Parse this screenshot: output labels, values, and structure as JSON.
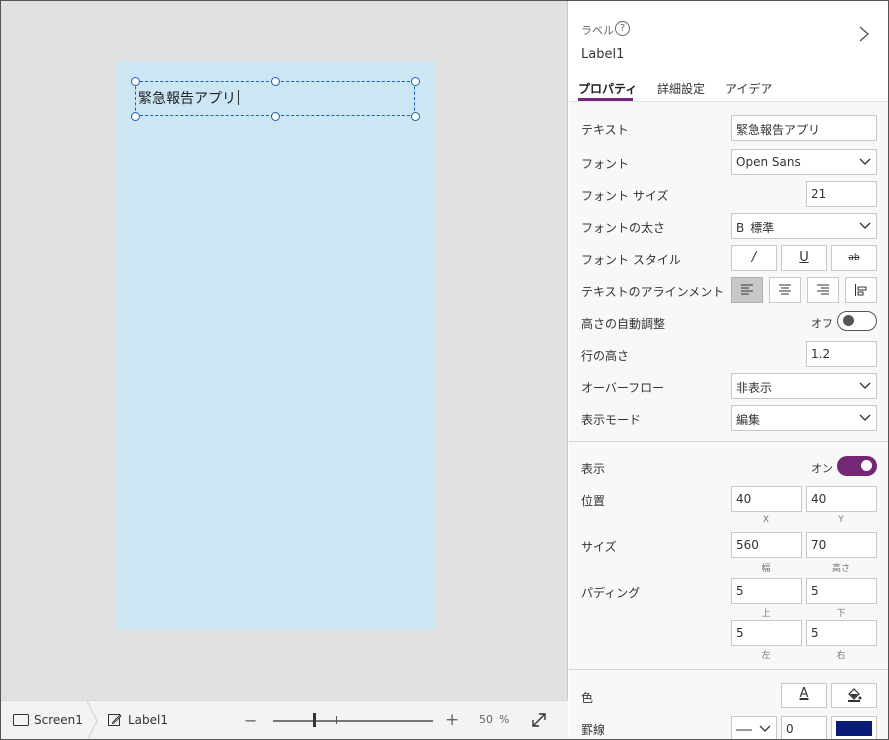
{
  "canvas": {
    "label_text": "緊急報告アプリ",
    "screen_color": "#cce6f4"
  },
  "statusbar": {
    "screen_crumb": "Screen1",
    "label_crumb": "Label1",
    "zoom_minus": "−",
    "zoom_plus": "+",
    "zoom_value": "50",
    "zoom_unit": "%",
    "zoom_level": 0.5
  },
  "panel": {
    "control_type": "ラベル",
    "help_glyph": "?",
    "control_name": "Label1",
    "tabs": [
      {
        "label": "プロパティ",
        "active": true
      },
      {
        "label": "詳細設定",
        "active": false
      },
      {
        "label": "アイデア",
        "active": false
      }
    ],
    "accent_color": "#742774",
    "properties": {
      "text": {
        "label": "テキスト",
        "value": "緊急報告アプリ"
      },
      "font": {
        "label": "フォント",
        "value": "Open Sans"
      },
      "font_size": {
        "label": "フォント サイズ",
        "value": "21"
      },
      "font_weight": {
        "label": "フォントの太さ",
        "prefix": "B",
        "value": "標準"
      },
      "font_style": {
        "label": "フォント スタイル",
        "italic": "/",
        "underline": "U",
        "strike": "ab"
      },
      "text_align": {
        "label": "テキストのアラインメント",
        "selected": "left"
      },
      "auto_height": {
        "label": "高さの自動調整",
        "state": "オフ"
      },
      "line_height": {
        "label": "行の高さ",
        "value": "1.2"
      },
      "overflow": {
        "label": "オーバーフロー",
        "value": "非表示"
      },
      "display_mode": {
        "label": "表示モード",
        "value": "編集"
      },
      "visible": {
        "label": "表示",
        "state": "オン"
      },
      "position": {
        "label": "位置",
        "x": "40",
        "y": "40",
        "x_caption": "X",
        "y_caption": "Y"
      },
      "size": {
        "label": "サイズ",
        "width": "560",
        "height": "70",
        "width_caption": "幅",
        "height_caption": "高さ"
      },
      "padding": {
        "label": "パディング",
        "top": "5",
        "bottom": "5",
        "left": "5",
        "right": "5",
        "top_caption": "上",
        "bottom_caption": "下",
        "left_caption": "左",
        "right_caption": "右"
      },
      "color": {
        "label": "色",
        "font_glyph": "A"
      },
      "border": {
        "label": "罫線",
        "value": "0",
        "swatch": "#0a1a78"
      }
    }
  }
}
